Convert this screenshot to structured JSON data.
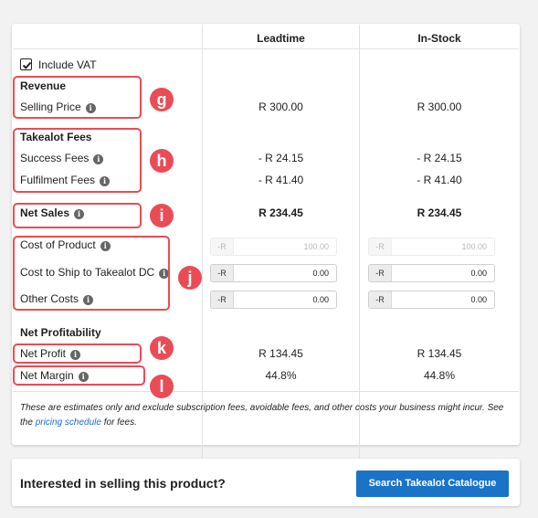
{
  "columns": {
    "leadtime": "Leadtime",
    "instock": "In-Stock"
  },
  "include_vat": {
    "label": "Include VAT",
    "checked": true
  },
  "sections": {
    "revenue": "Revenue",
    "takealot_fees": "Takealot Fees",
    "net_profitability": "Net Profitability"
  },
  "rows": {
    "selling_price": {
      "label": "Selling Price",
      "leadtime": "R 300.00",
      "instock": "R 300.00"
    },
    "success_fees": {
      "label": "Success Fees",
      "leadtime": "- R 24.15",
      "instock": "- R 24.15"
    },
    "fulfilment_fees": {
      "label": "Fulfilment Fees",
      "leadtime": "- R 41.40",
      "instock": "- R 41.40"
    },
    "net_sales": {
      "label": "Net Sales",
      "leadtime": "R 234.45",
      "instock": "R 234.45"
    },
    "cost_of_product": {
      "label": "Cost of Product",
      "prefix": "-R",
      "leadtime": "100.00",
      "instock": "100.00"
    },
    "cost_to_ship": {
      "label": "Cost to Ship to Takealot DC",
      "prefix": "-R",
      "leadtime": "0.00",
      "instock": "0.00"
    },
    "other_costs": {
      "label": "Other Costs",
      "prefix": "-R",
      "leadtime": "0.00",
      "instock": "0.00"
    },
    "net_profit": {
      "label": "Net Profit",
      "leadtime": "R 134.45",
      "instock": "R 134.45"
    },
    "net_margin": {
      "label": "Net Margin",
      "leadtime": "44.8%",
      "instock": "44.8%"
    }
  },
  "info_icon": "i",
  "annotations": {
    "g": "g",
    "h": "h",
    "i": "i",
    "j": "j",
    "k": "k",
    "l": "l"
  },
  "note": {
    "text_before": "These are estimates only and exclude subscription fees, avoidable fees, and other costs your business might incur. See the ",
    "link": "pricing schedule",
    "text_after": " for fees."
  },
  "cta": {
    "question": "Interested in selling this product?",
    "button": "Search Takealot Catalogue"
  },
  "colors": {
    "accent": "#1a73c6",
    "annotation": "#ea4c55"
  }
}
